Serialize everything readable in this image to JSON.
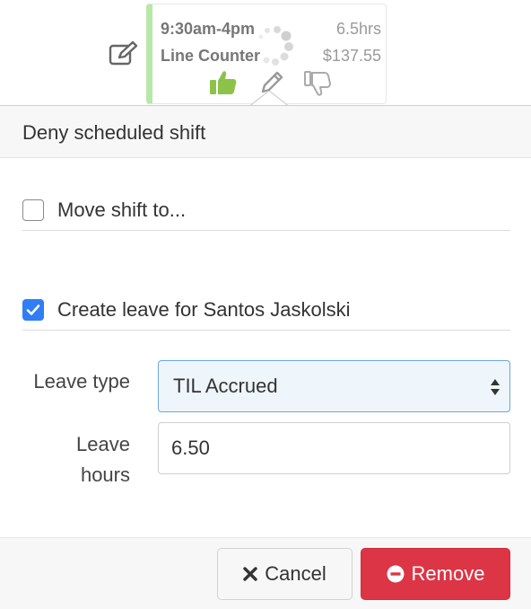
{
  "shift": {
    "time": "9:30am-4pm",
    "hours": "6.5hrs",
    "role": "Line Counter",
    "cost": "$137.55"
  },
  "icons": {
    "edit": "edit-icon",
    "thumb_up": "thumb-up-icon",
    "thumb_down": "thumb-down-icon",
    "pencil": "pencil-icon",
    "spinner": "loading-spinner-icon"
  },
  "colors": {
    "approve_green": "#8bc34a",
    "shift_border": "#b6e8a8",
    "checkbox_blue": "#2f7ef6",
    "remove_red": "#dc3545"
  },
  "popover": {
    "title": "Deny scheduled shift",
    "move_shift": {
      "label": "Move shift to...",
      "checked": false
    },
    "create_leave": {
      "label": "Create leave for Santos Jaskolski",
      "checked": true
    },
    "leave_type": {
      "label": "Leave type",
      "selected": "TIL Accrued"
    },
    "leave_hours": {
      "label_line1": "Leave",
      "label_line2": "hours",
      "value": "6.50"
    },
    "cancel_label": "Cancel",
    "remove_label": "Remove"
  }
}
